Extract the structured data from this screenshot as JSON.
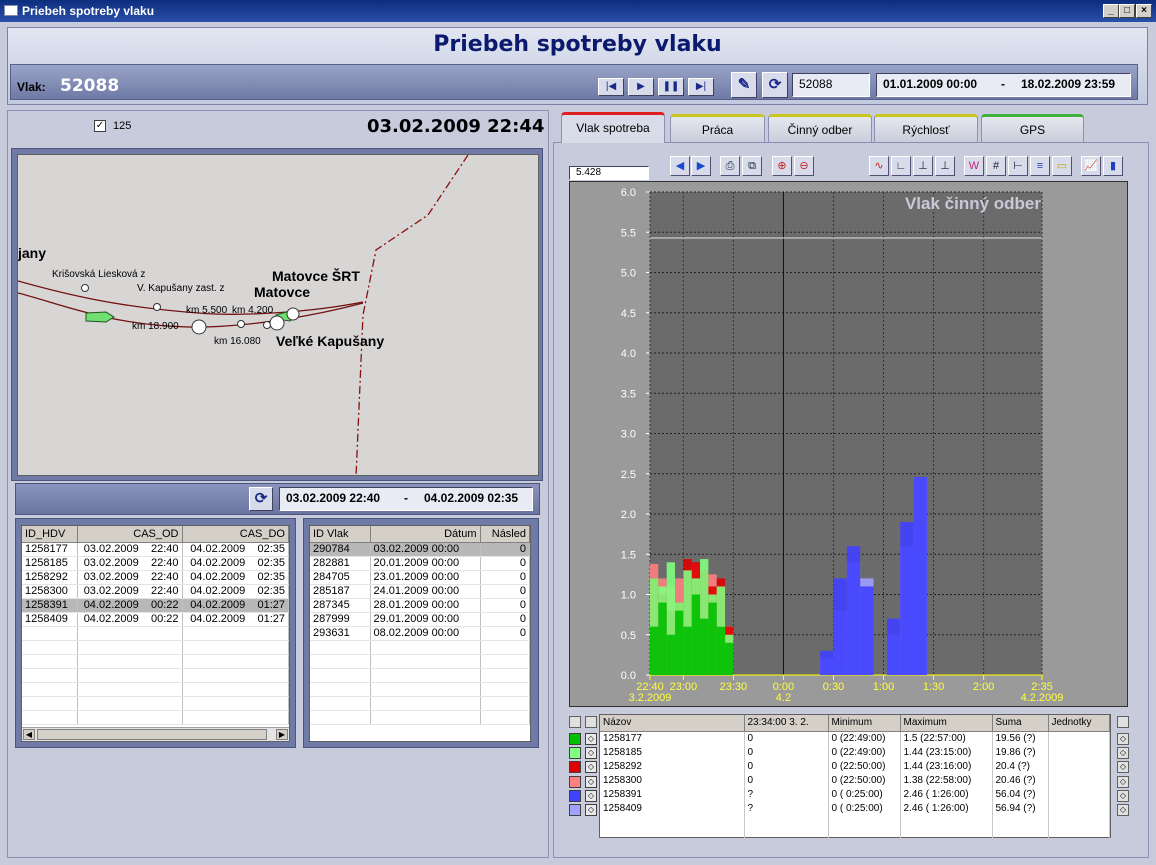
{
  "window": {
    "title": "Priebeh spotreby vlaku"
  },
  "header": {
    "title": "Priebeh spotreby vlaku",
    "vlak_label": "Vlak:",
    "vlak_value": "52088",
    "train_field": "52088",
    "date_from": "01.01.2009 00:00",
    "date_sep": "-",
    "date_to": "18.02.2009 23:59"
  },
  "left": {
    "checkbox_label": "125",
    "current_datetime": "03.02.2009 22:44",
    "range_from": "03.02.2009 22:40",
    "range_sep": "-",
    "range_to": "04.02.2009 02:35"
  },
  "map": {
    "labels": {
      "jany": "jany",
      "krisovska": "Krišovská Liesková z",
      "kapusany_zast": "V. Kapušany zast. z",
      "matovce_srt": "Matovce ŠRT",
      "matovce": "Matovce",
      "km5500": "km 5.500",
      "km4200": "km 4.200",
      "km18900": "km 18.900",
      "km16080": "km 16.080",
      "velke_kapusany": "Veľké Kapušany"
    }
  },
  "hdv_table": {
    "columns": [
      "ID_HDV",
      "CAS_OD",
      "CAS_DO"
    ],
    "rows": [
      [
        "1258177",
        "03.02.2009    22:40",
        "04.02.2009    02:35"
      ],
      [
        "1258185",
        "03.02.2009    22:40",
        "04.02.2009    02:35"
      ],
      [
        "1258292",
        "03.02.2009    22:40",
        "04.02.2009    02:35"
      ],
      [
        "1258300",
        "03.02.2009    22:40",
        "04.02.2009    02:35"
      ],
      [
        "1258391",
        "04.02.2009    00:22",
        "04.02.2009    01:27"
      ],
      [
        "1258409",
        "04.02.2009    00:22",
        "04.02.2009    01:27"
      ]
    ],
    "selected_row": 4
  },
  "vlak_table": {
    "columns": [
      "ID Vlak",
      "Dátum",
      "Násled"
    ],
    "rows": [
      [
        "290784",
        "03.02.2009 00:00",
        "0"
      ],
      [
        "282881",
        "20.01.2009 00:00",
        "0"
      ],
      [
        "284705",
        "23.01.2009 00:00",
        "0"
      ],
      [
        "285187",
        "24.01.2009 00:00",
        "0"
      ],
      [
        "287345",
        "28.01.2009 00:00",
        "0"
      ],
      [
        "287999",
        "29.01.2009 00:00",
        "0"
      ],
      [
        "293631",
        "08.02.2009 00:00",
        "0"
      ]
    ],
    "selected_row": 0
  },
  "tabs": [
    {
      "label": "Vlak spotreba",
      "color": "#e02020"
    },
    {
      "label": "Práca",
      "color": "#c8c820"
    },
    {
      "label": "Činný odber",
      "color": "#c8c820"
    },
    {
      "label": "Rýchlosť",
      "color": "#c8c820"
    },
    {
      "label": "GPS",
      "color": "#40b040"
    }
  ],
  "chart_value_field": "5.428",
  "chart_data": {
    "type": "area",
    "title": "Vlak činný odber",
    "ylim": [
      0,
      6
    ],
    "yticks": [
      "0.0",
      "0.5",
      "1.0",
      "1.5",
      "2.0",
      "2.5",
      "3.0",
      "3.5",
      "4.0",
      "4.5",
      "5.0",
      "5.5",
      "6.0"
    ],
    "reference_line": 5.428,
    "xticks": [
      {
        "label": "22:40",
        "sub": "3.2.2009"
      },
      {
        "label": "23:00",
        "sub": ""
      },
      {
        "label": "23:30",
        "sub": ""
      },
      {
        "label": "0:00",
        "sub": "4.2"
      },
      {
        "label": "0:30",
        "sub": ""
      },
      {
        "label": "1:00",
        "sub": ""
      },
      {
        "label": "1:30",
        "sub": ""
      },
      {
        "label": "2:00",
        "sub": ""
      },
      {
        "label": "2:35",
        "sub": "4.2.2009"
      }
    ],
    "series": [
      {
        "name": "1258177",
        "color": "#00c000",
        "x": [
          "22:40",
          "22:45",
          "22:50",
          "22:55",
          "23:00",
          "23:05",
          "23:10",
          "23:15",
          "23:20",
          "23:25",
          "23:30"
        ],
        "values": [
          0.6,
          0.9,
          0.5,
          0.8,
          0.6,
          1.0,
          0.7,
          0.9,
          0.6,
          0.4,
          0.1
        ]
      },
      {
        "name": "1258185",
        "color": "#80ff80",
        "x": [
          "22:40",
          "22:45",
          "22:50",
          "22:55",
          "23:00",
          "23:05",
          "23:10",
          "23:15",
          "23:20",
          "23:25",
          "23:30"
        ],
        "values": [
          1.2,
          1.1,
          1.4,
          0.9,
          1.3,
          1.2,
          1.44,
          1.0,
          1.1,
          0.5,
          0.1
        ]
      },
      {
        "name": "1258292",
        "color": "#e00000",
        "x": [
          "22:40",
          "22:45",
          "22:50",
          "22:55",
          "23:00",
          "23:05",
          "23:10",
          "23:15",
          "23:20",
          "23:25",
          "23:30"
        ],
        "values": [
          1.2,
          1.0,
          0.8,
          0.9,
          1.44,
          1.4,
          1.3,
          1.1,
          1.2,
          0.6,
          0.1
        ]
      },
      {
        "name": "1258300",
        "color": "#ff8080",
        "x": [
          "22:40",
          "22:45",
          "22:50",
          "22:55",
          "23:00",
          "23:05",
          "23:10",
          "23:15",
          "23:20",
          "23:25",
          "23:30"
        ],
        "values": [
          1.38,
          1.2,
          1.1,
          1.2,
          1.3,
          1.38,
          1.2,
          1.25,
          1.1,
          0.6,
          0.1
        ]
      },
      {
        "name": "1258391",
        "color": "#4040ff",
        "x": [
          "0:22",
          "0:30",
          "0:38",
          "0:46",
          "0:54",
          "1:02",
          "1:10",
          "1:18",
          "1:26"
        ],
        "values": [
          0.3,
          1.2,
          1.6,
          1.1,
          0.0,
          0.7,
          1.9,
          2.46,
          2.2
        ]
      },
      {
        "name": "1258409",
        "color": "#a0a0ff",
        "x": [
          "0:22",
          "0:30",
          "0:38",
          "0:46",
          "0:54",
          "1:02",
          "1:10",
          "1:18",
          "1:26"
        ],
        "values": [
          0.2,
          0.8,
          1.4,
          1.2,
          0.0,
          0.5,
          1.6,
          2.46,
          1.9
        ]
      }
    ]
  },
  "legend_table": {
    "columns": [
      "Názov",
      "23:34:00 3. 2.",
      "Minimum",
      "Maximum",
      "Suma",
      "Jednotky"
    ],
    "rows": [
      {
        "name": "1258177",
        "color": "#00c000",
        "cur": "0",
        "min": "0 (22:49:00)",
        "max": "1.5   (22:57:00)",
        "sum": "19.56 (?)"
      },
      {
        "name": "1258185",
        "color": "#80ff80",
        "cur": "0",
        "min": "0 (22:49:00)",
        "max": "1.44  (23:15:00)",
        "sum": "19.86 (?)"
      },
      {
        "name": "1258292",
        "color": "#e00000",
        "cur": "0",
        "min": "0 (22:50:00)",
        "max": "1.44  (23:16:00)",
        "sum": "20.4   (?)"
      },
      {
        "name": "1258300",
        "color": "#ff8080",
        "cur": "0",
        "min": "0 (22:50:00)",
        "max": "1.38  (22:58:00)",
        "sum": "20.46 (?)"
      },
      {
        "name": "1258391",
        "color": "#4040ff",
        "cur": "?",
        "min": "0 (  0:25:00)",
        "max": "2.46  (  1:26:00)",
        "sum": "56.04 (?)"
      },
      {
        "name": "1258409",
        "color": "#a0a0ff",
        "cur": "?",
        "min": "0 (  0:25:00)",
        "max": "2.46  (  1:26:00)",
        "sum": "56.94 (?)"
      }
    ]
  }
}
